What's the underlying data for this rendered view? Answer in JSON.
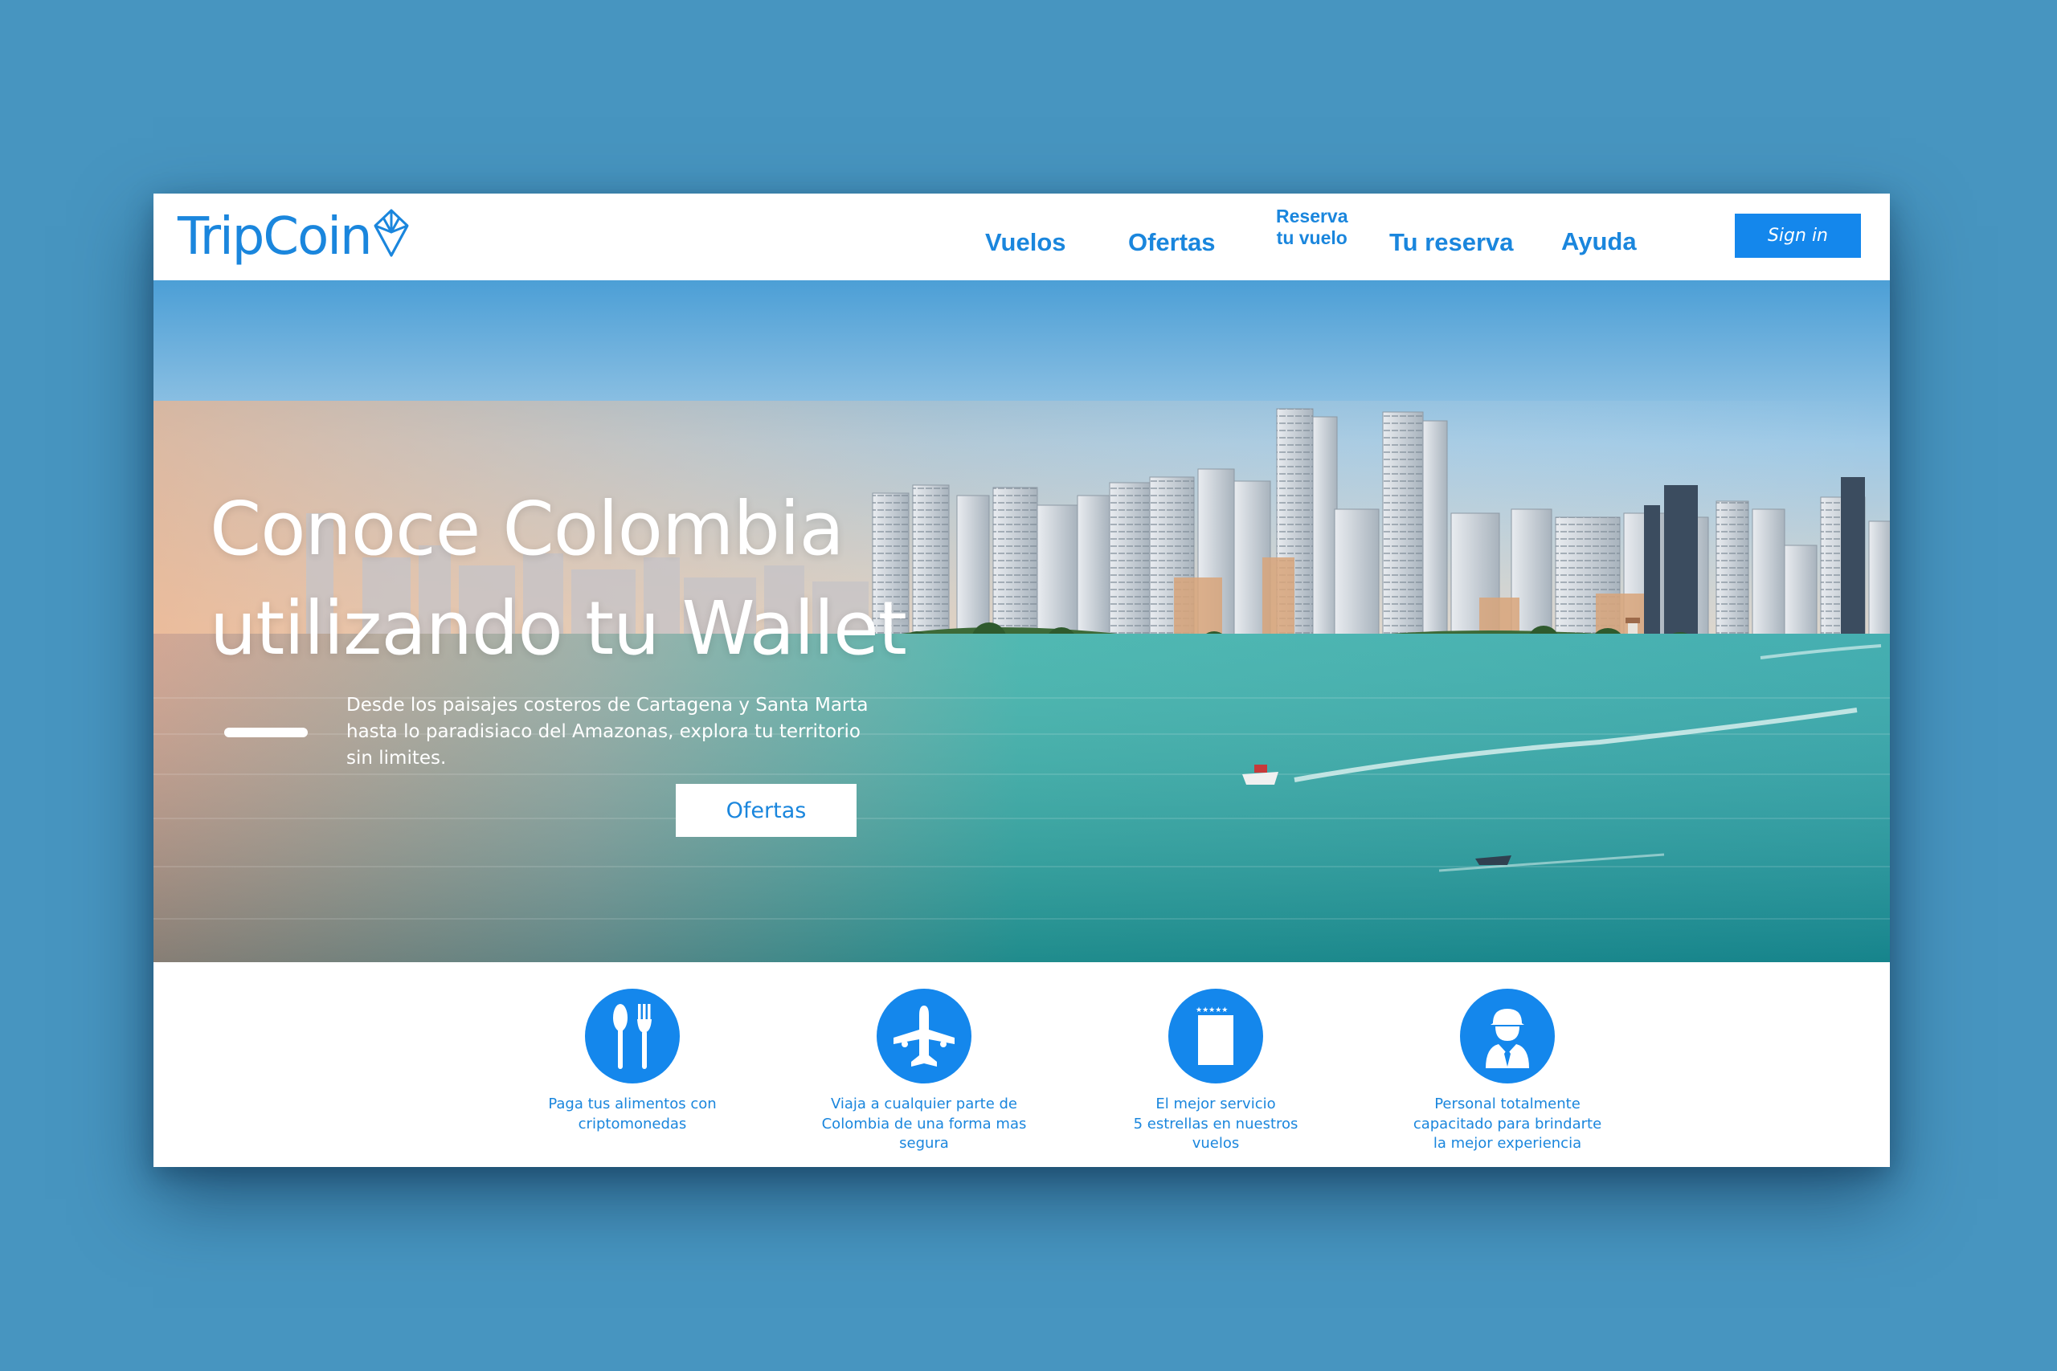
{
  "brand": {
    "name": "TripCoin",
    "color": "#1a86dd",
    "accent": "#1487ec",
    "logo_icon": "gem-icon"
  },
  "nav": {
    "items": [
      {
        "label": "Vuelos"
      },
      {
        "label": "Ofertas"
      },
      {
        "label": "Reserva tu vuelo",
        "line1": "Reserva",
        "line2": "tu vuelo"
      },
      {
        "label": "Tu reserva"
      },
      {
        "label": "Ayuda"
      }
    ],
    "signin_label": "Sign in"
  },
  "hero": {
    "title_line1": "Conoce Colombia",
    "title_line2": "utilizando tu Wallet",
    "description_line1": "Desde los paisajes costeros de Cartagena y Santa Marta",
    "description_line2": "hasta lo paradisiaco del Amazonas, explora tu territorio",
    "description_line3": "sin limites.",
    "button_label": "Ofertas"
  },
  "features": [
    {
      "icon": "utensils-icon",
      "text": "Paga tus alimentos con\ncriptomonedas"
    },
    {
      "icon": "airplane-icon",
      "text": "Viaja a cualquier parte de\nColombia de una forma mas\nsegura"
    },
    {
      "icon": "five-star-card-icon",
      "text": "El mejor servicio\n5 estrellas en nuestros\nvuelos"
    },
    {
      "icon": "staff-person-icon",
      "text": "Personal totalmente\ncapacitado para brindarte\nla mejor experiencia"
    }
  ]
}
